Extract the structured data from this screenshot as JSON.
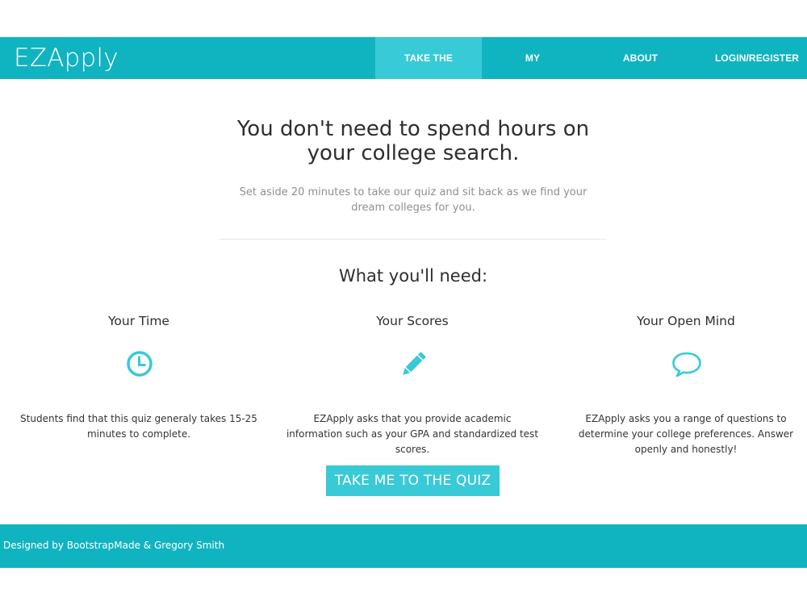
{
  "colors": {
    "primary": "#10b4c0",
    "accent": "#38cad6",
    "text": "#2e2e2e",
    "muted": "#8f8f8f"
  },
  "navbar": {
    "brand": "EZApply",
    "items": [
      {
        "label": "TAKE THE QUIZ",
        "active": true
      },
      {
        "label": "MY COLLEGES",
        "active": false
      },
      {
        "label": "ABOUT EZAPPLY",
        "active": false
      },
      {
        "label": "LOGIN/REGISTER",
        "active": false
      }
    ]
  },
  "hero": {
    "title": "You don't need to spend hours on your college search.",
    "subtitle": "Set aside 20 minutes to take our quiz and sit back as we find your dream colleges for you."
  },
  "needs": {
    "heading": "What you'll need:",
    "columns": [
      {
        "title": "Your Time",
        "icon": "clock-icon",
        "text": "Students find that this quiz generaly takes 15-25 minutes to complete."
      },
      {
        "title": "Your Scores",
        "icon": "pencil-icon",
        "text": "EZApply asks that you provide academic information such as your GPA and standardized test scores."
      },
      {
        "title": "Your Open Mind",
        "icon": "speech-bubble-icon",
        "text": "EZApply asks you a range of questions to determine your college preferences. Answer openly and honestly!"
      }
    ]
  },
  "cta": {
    "label": "TAKE ME TO THE QUIZ"
  },
  "footer": {
    "text": "Designed by BootstrapMade & Gregory Smith"
  }
}
